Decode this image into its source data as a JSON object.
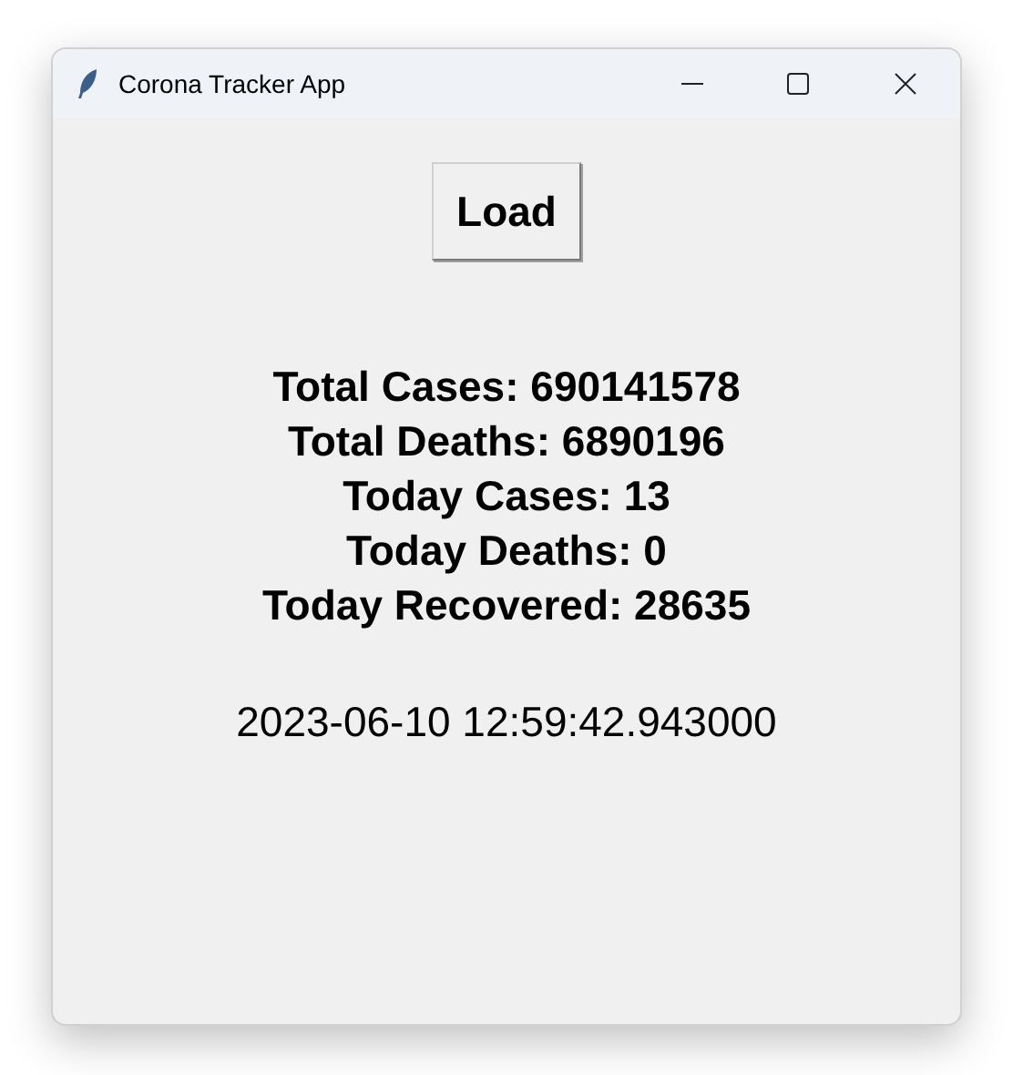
{
  "window": {
    "title": "Corona Tracker App"
  },
  "load_button": "Load",
  "stats": [
    "Total Cases: 690141578",
    "Total Deaths: 6890196",
    "Today Cases: 13",
    "Today Deaths: 0",
    "Today Recovered: 28635"
  ],
  "timestamp": "2023-06-10 12:59:42.943000"
}
